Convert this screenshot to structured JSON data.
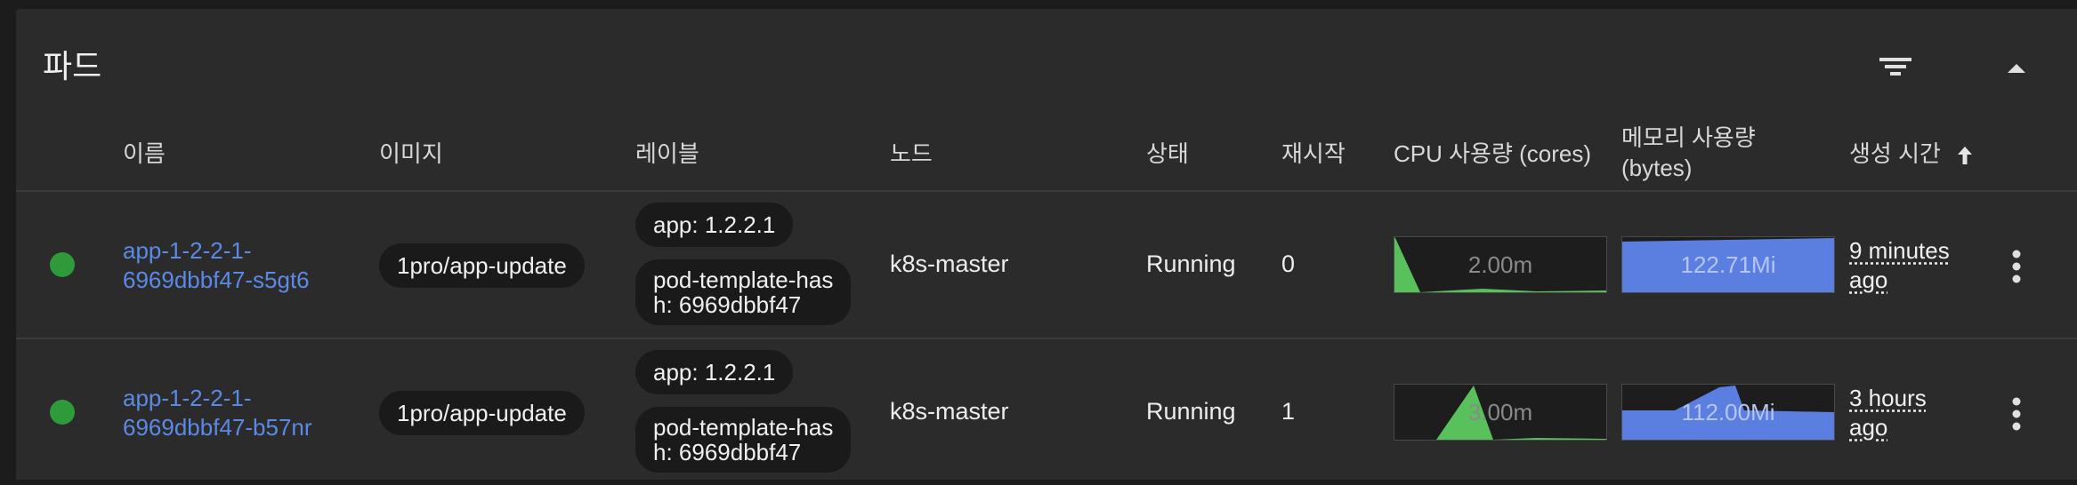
{
  "card": {
    "title": "파드",
    "filter_icon": "filter-list-icon",
    "collapse_icon": "arrow-up-icon"
  },
  "columns": {
    "name": "이름",
    "image": "이미지",
    "labels": "레이블",
    "node": "노드",
    "status": "상태",
    "restarts": "재시작",
    "cpu": "CPU 사용량 (cores)",
    "memory_line1": "메모리 사용량",
    "memory_line2": "(bytes)",
    "created": "생성 시간",
    "sort_icon": "arrow-upward-icon"
  },
  "colors": {
    "running": "#2f9a3a",
    "link": "#5b8ae6",
    "cpu_fill": "#58c15c",
    "mem_fill": "#5b7fe0"
  },
  "rows": [
    {
      "name_line1": "app-1-2-2-1-",
      "name_line2": "6969dbbf47-s5gt6",
      "image": "1pro/app-update",
      "label1": "app: 1.2.2.1",
      "label2_line1": "pod-template-has",
      "label2_line2": "h: 6969dbbf47",
      "node": "k8s-master",
      "status": "Running",
      "restarts": "0",
      "cpu": "2.00m",
      "memory": "122.71Mi",
      "age_line1": "9 minutes",
      "age_line2": "ago"
    },
    {
      "name_line1": "app-1-2-2-1-",
      "name_line2": "6969dbbf47-b57nr",
      "image": "1pro/app-update",
      "label1": "app: 1.2.2.1",
      "label2_line1": "pod-template-has",
      "label2_line2": "h: 6969dbbf47",
      "node": "k8s-master",
      "status": "Running",
      "restarts": "1",
      "cpu": "3.00m",
      "memory": "112.00Mi",
      "age_line1": "3 hours",
      "age_line2": "ago"
    }
  ]
}
